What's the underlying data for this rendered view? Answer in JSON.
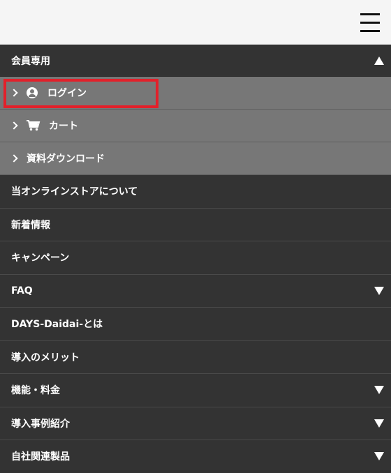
{
  "colors": {
    "topbar": "#f5f5f5",
    "menu_bg": "#333333",
    "submenu_bg": "#777777",
    "highlight": "#e3202a",
    "text": "#ffffff"
  },
  "header": {
    "menu_icon": "hamburger-icon"
  },
  "members": {
    "label": "会員専用",
    "items": [
      {
        "label": "ログイン",
        "icon": "user-circle-icon",
        "highlighted": true
      },
      {
        "label": "カート",
        "icon": "cart-icon"
      },
      {
        "label": "資料ダウンロード"
      }
    ]
  },
  "nav": [
    {
      "label": "当オンラインストアについて",
      "expandable": false
    },
    {
      "label": "新着情報",
      "expandable": false
    },
    {
      "label": "キャンペーン",
      "expandable": false
    },
    {
      "label": "FAQ",
      "expandable": true
    },
    {
      "label": "DAYS-Daidai-とは",
      "expandable": false
    },
    {
      "label": "導入のメリット",
      "expandable": false
    },
    {
      "label": "機能・料金",
      "expandable": true
    },
    {
      "label": "導入事例紹介",
      "expandable": true
    },
    {
      "label": "自社関連製品",
      "expandable": true
    }
  ]
}
